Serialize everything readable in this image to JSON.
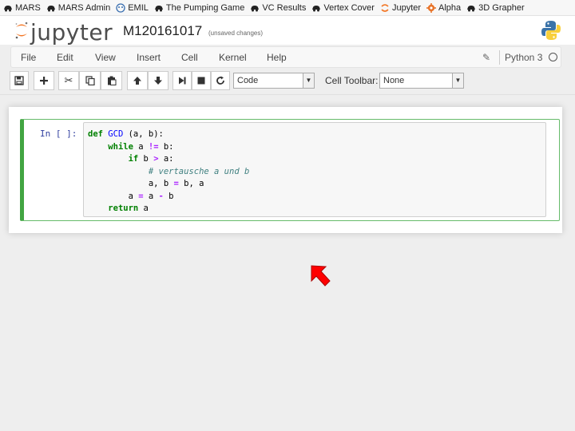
{
  "bookmarks": [
    {
      "label": "MARS",
      "icon": "car-icon"
    },
    {
      "label": "MARS Admin",
      "icon": "car-icon"
    },
    {
      "label": "EMIL",
      "icon": "emil-icon"
    },
    {
      "label": "The Pumping Game",
      "icon": "car-icon"
    },
    {
      "label": "VC Results",
      "icon": "car-icon"
    },
    {
      "label": "Vertex Cover",
      "icon": "car-icon"
    },
    {
      "label": "Jupyter",
      "icon": "jupyter-icon"
    },
    {
      "label": "Alpha",
      "icon": "gear-icon"
    },
    {
      "label": "3D Grapher",
      "icon": "car-icon"
    }
  ],
  "header": {
    "logo_text": "jupyter",
    "notebook_name": "M120161017",
    "save_status": "(unsaved changes)"
  },
  "menu": [
    "File",
    "Edit",
    "View",
    "Insert",
    "Cell",
    "Kernel",
    "Help"
  ],
  "kernel": {
    "name": "Python 3",
    "indicator": "idle-circle-icon"
  },
  "toolbar": {
    "buttons": [
      "save-icon",
      "plus-icon",
      "cut-icon",
      "copy-icon",
      "paste-icon",
      "arrow-up-icon",
      "arrow-down-icon",
      "step-forward-icon",
      "stop-icon",
      "refresh-icon"
    ],
    "cell_type": "Code",
    "cell_toolbar_label": "Cell Toolbar:",
    "cell_toolbar_value": "None"
  },
  "cell": {
    "prompt": "In [ ]:",
    "code": [
      "def GCD (a, b):",
      "    while a != b:",
      "        if b > a:",
      "            # vertausche a und b",
      "            a, b = b, a",
      "        a = a - b",
      "    return a"
    ]
  },
  "colors": {
    "cell_border": "#42a542",
    "cursor": "#ff0000",
    "jupyter_orange": "#f37726"
  }
}
